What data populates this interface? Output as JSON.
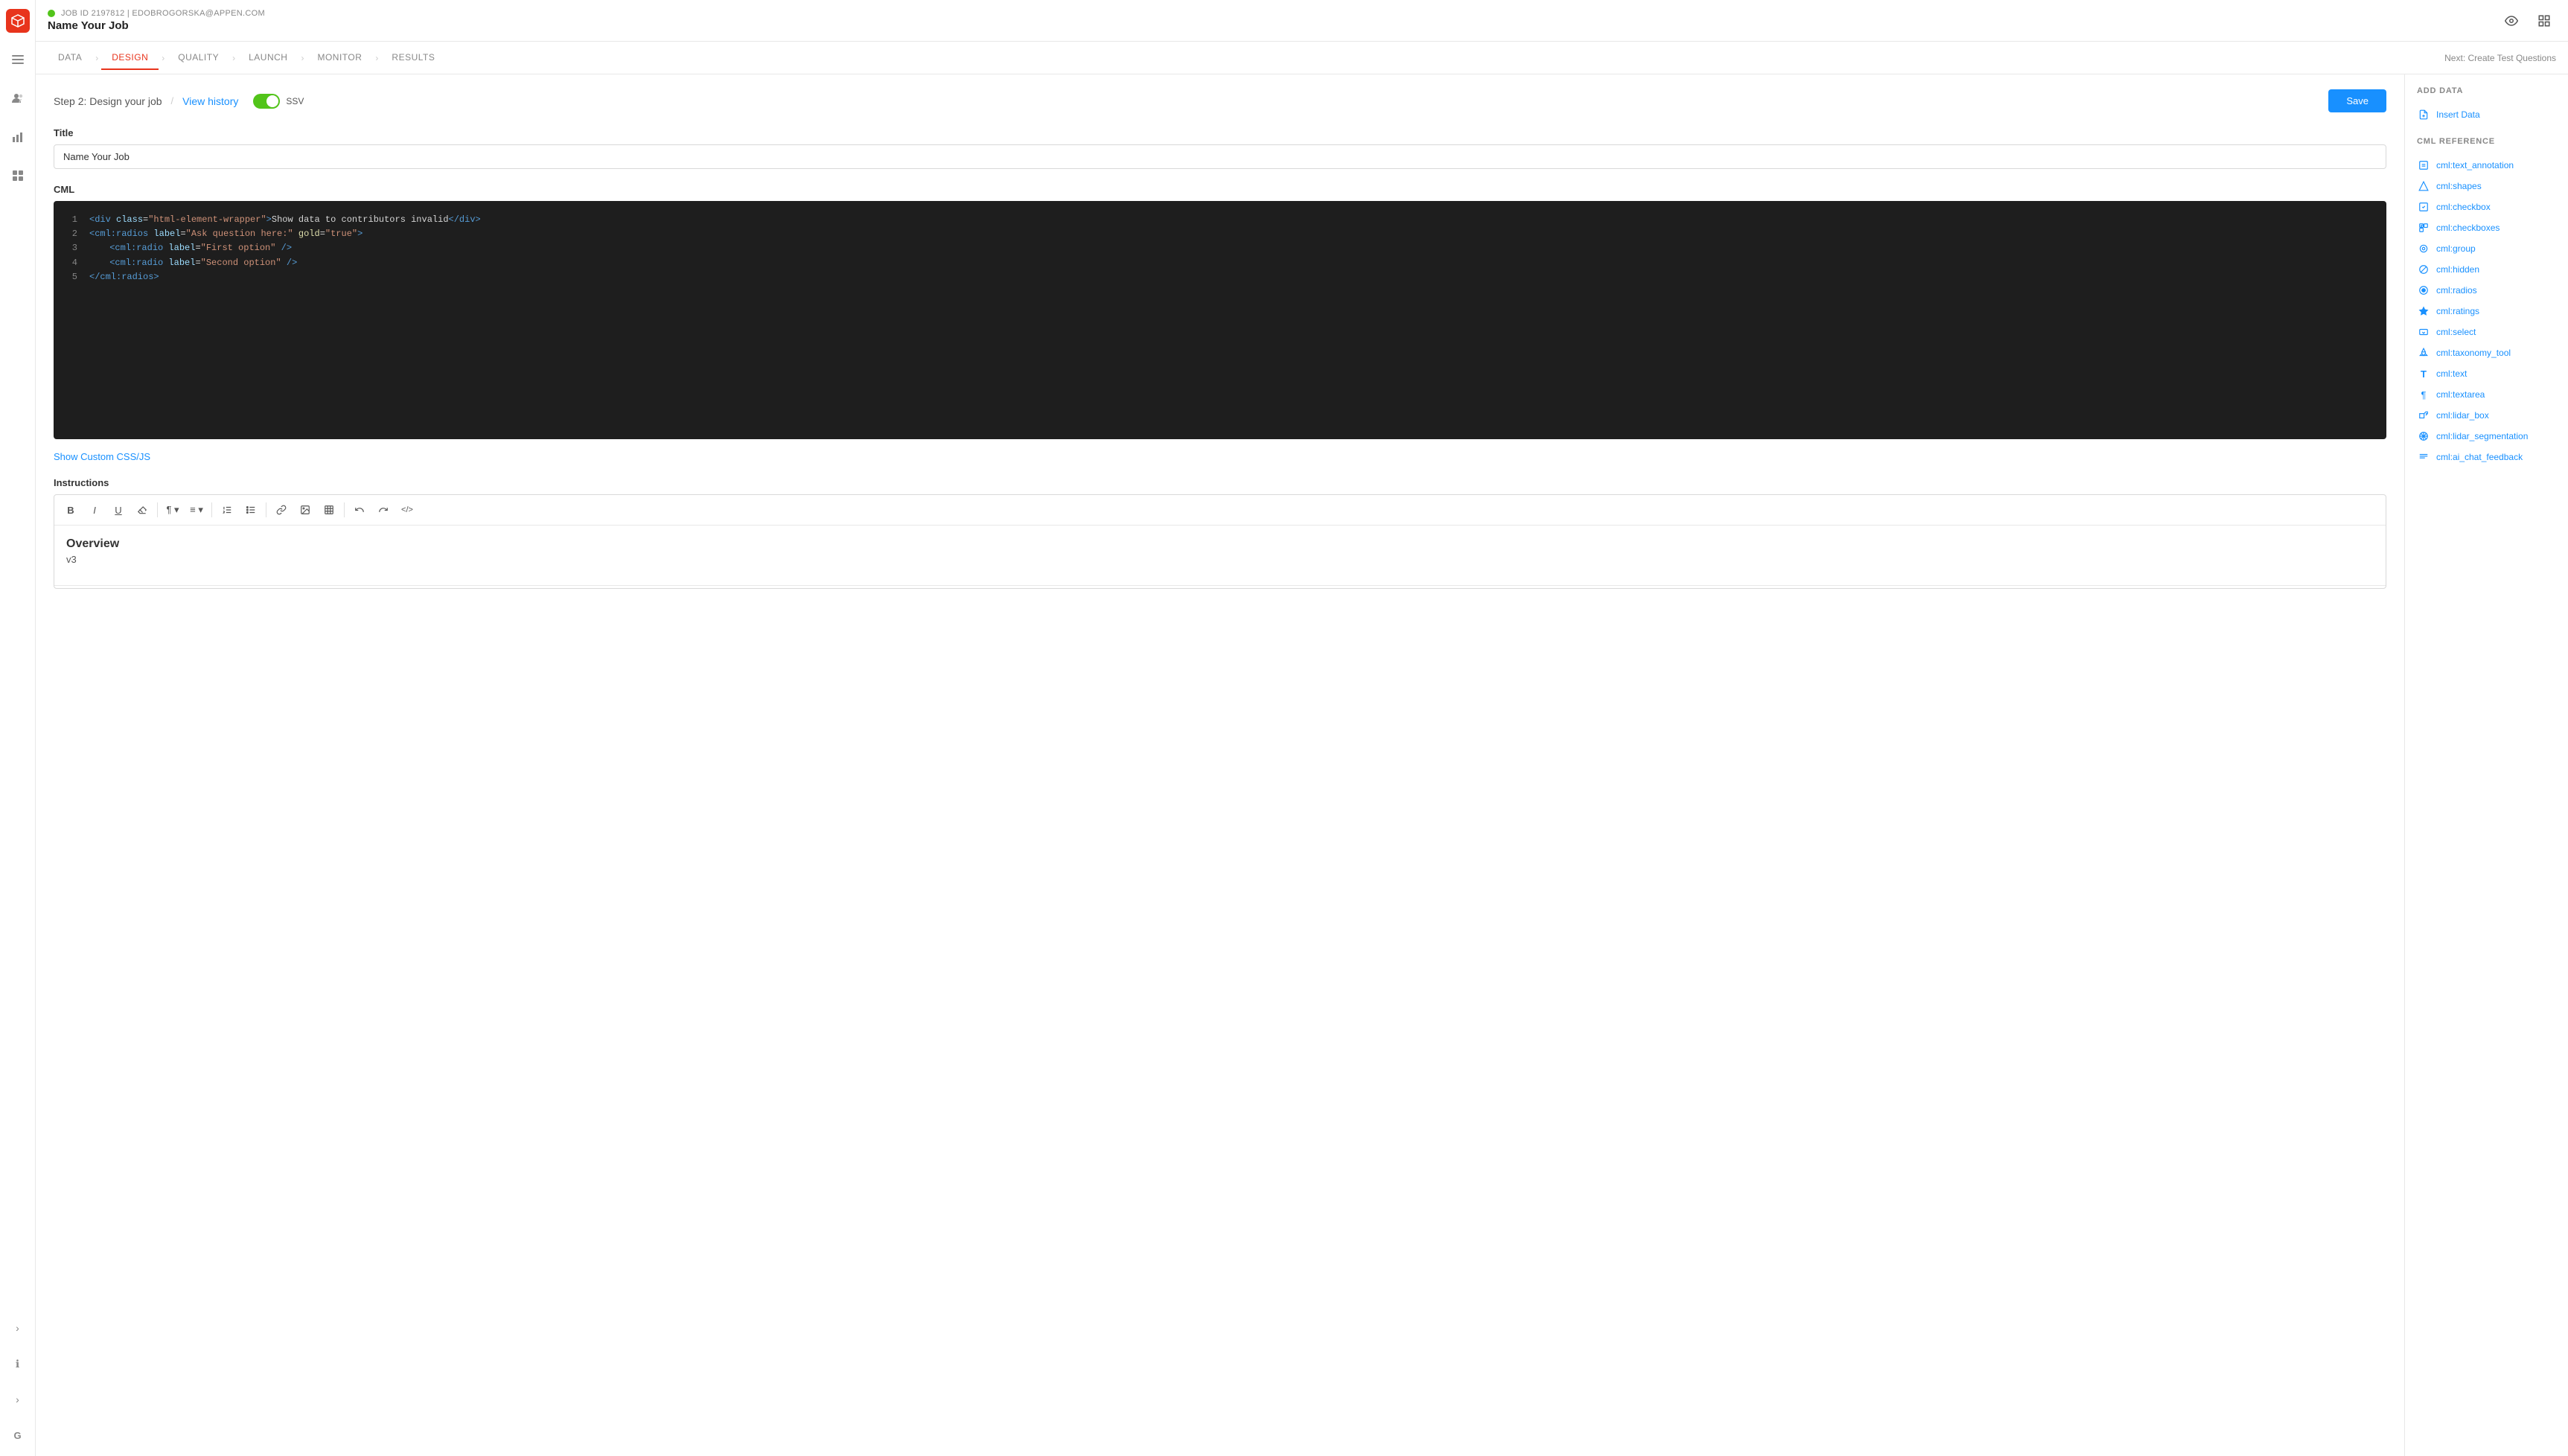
{
  "header": {
    "job_id_label": "JOB ID 2197812 | EDOBROGORSKA@APPEN.COM",
    "job_title": "Name Your Job",
    "eye_icon": "👁",
    "grid_icon": "⊞"
  },
  "nav": {
    "tabs": [
      {
        "label": "DATA",
        "active": false
      },
      {
        "label": "DESIGN",
        "active": true
      },
      {
        "label": "QUALITY",
        "active": false
      },
      {
        "label": "LAUNCH",
        "active": false
      },
      {
        "label": "MONITOR",
        "active": false
      },
      {
        "label": "RESULTS",
        "active": false
      }
    ],
    "next_label": "Next: Create Test Questions"
  },
  "step": {
    "title": "Step 2: Design your job",
    "separator": "/",
    "view_history": "View history",
    "toggle_label": "SSV",
    "toggle_on": true,
    "save_button": "Save"
  },
  "title_field": {
    "label": "Title",
    "value": "Name Your Job"
  },
  "cml_field": {
    "label": "CML",
    "code_lines": [
      {
        "num": "1",
        "html": "<div class=\"html-element-wrapper\">Show data to contributors invalid</div>"
      },
      {
        "num": "2",
        "html": "<cml:radios label=\"Ask question here:\" gold=\"true\">"
      },
      {
        "num": "3",
        "html": "  <cml:radio label=\"First option\" />"
      },
      {
        "num": "4",
        "html": "  <cml:radio label=\"Second option\" />"
      },
      {
        "num": "5",
        "html": "</cml:radios>"
      }
    ]
  },
  "show_css_link": "Show Custom CSS/JS",
  "instructions": {
    "label": "Instructions",
    "toolbar": {
      "bold": "B",
      "italic": "I",
      "underline": "U",
      "eraser": "⌫",
      "paragraph": "¶",
      "align": "≡",
      "ol": "1.",
      "ul": "•",
      "link": "🔗",
      "image": "🖼",
      "table": "⊞",
      "undo": "↩",
      "redo": "↪",
      "code": "<>"
    },
    "content_heading": "Overview",
    "content_body": "v3"
  },
  "right_sidebar": {
    "add_data_title": "ADD DATA",
    "add_data_items": [
      {
        "label": "Insert Data",
        "icon": "📄"
      }
    ],
    "cml_ref_title": "CML REFERENCE",
    "cml_ref_items": [
      {
        "label": "cml:text_annotation",
        "icon": "⬜"
      },
      {
        "label": "cml:shapes",
        "icon": "◈"
      },
      {
        "label": "cml:checkbox",
        "icon": "☑"
      },
      {
        "label": "cml:checkboxes",
        "icon": "☑"
      },
      {
        "label": "cml:group",
        "icon": "⊙"
      },
      {
        "label": "cml:hidden",
        "icon": "⊘"
      },
      {
        "label": "cml:radios",
        "icon": "◎"
      },
      {
        "label": "cml:ratings",
        "icon": "★"
      },
      {
        "label": "cml:select",
        "icon": "▽"
      },
      {
        "label": "cml:taxonomy_tool",
        "icon": "❖"
      },
      {
        "label": "cml:text",
        "icon": "T"
      },
      {
        "label": "cml:textarea",
        "icon": "¶"
      },
      {
        "label": "cml:lidar_box",
        "icon": "◈"
      },
      {
        "label": "cml:lidar_segmentation",
        "icon": "◈"
      },
      {
        "label": "cml:ai_chat_feedback",
        "icon": "≡"
      }
    ]
  },
  "left_sidebar": {
    "icons": [
      {
        "name": "hamburger-icon",
        "glyph": "☰"
      },
      {
        "name": "people-icon",
        "glyph": "👥"
      },
      {
        "name": "chart-icon",
        "glyph": "📊"
      },
      {
        "name": "grid-icon",
        "glyph": "⊞"
      }
    ],
    "bottom_icons": [
      {
        "name": "expand-icon",
        "glyph": "›"
      },
      {
        "name": "info-icon",
        "glyph": "ℹ"
      },
      {
        "name": "expand2-icon",
        "glyph": "›"
      },
      {
        "name": "g-icon",
        "glyph": "G"
      }
    ]
  }
}
